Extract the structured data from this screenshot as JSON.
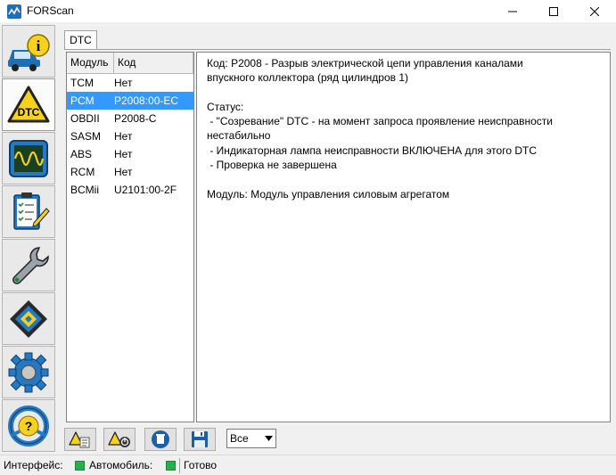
{
  "window": {
    "title": "FORScan"
  },
  "nav": {
    "items": [
      {
        "id": "info",
        "icon": "vehicle-info-icon"
      },
      {
        "id": "dtc",
        "icon": "dtc-warning-icon",
        "active": true
      },
      {
        "id": "oscilloscope",
        "icon": "oscilloscope-icon"
      },
      {
        "id": "tests",
        "icon": "checklist-icon"
      },
      {
        "id": "service",
        "icon": "wrench-icon"
      },
      {
        "id": "configuration",
        "icon": "chip-icon"
      },
      {
        "id": "settings",
        "icon": "gear-icon"
      },
      {
        "id": "help",
        "icon": "help-steering-icon"
      }
    ]
  },
  "tabs": [
    {
      "label": "DTC"
    }
  ],
  "modules": {
    "headers": {
      "module": "Модуль",
      "code": "Код"
    },
    "rows": [
      {
        "module": "TCM",
        "code": "Нет"
      },
      {
        "module": "PCM",
        "code": "P2008:00-EC",
        "selected": true
      },
      {
        "module": "OBDII",
        "code": "P2008-C"
      },
      {
        "module": "SASM",
        "code": "Нет"
      },
      {
        "module": "ABS",
        "code": "Нет"
      },
      {
        "module": "RCM",
        "code": "Нет"
      },
      {
        "module": "BCMii",
        "code": "U2101:00-2F"
      }
    ]
  },
  "details": {
    "line1": "Код: P2008 - Разрыв электрической цепи управления каналами",
    "line2": "впускного коллектора (ряд цилиндров 1)",
    "status_label": "Статус:",
    "status1a": " - \"Созревание\" DTC - на момент запроса проявление неисправности",
    "status1b": "нестабильно",
    "status2": " - Индикаторная лампа неисправности ВКЛЮЧЕНА для этого DTC",
    "status3": " - Проверка не завершена",
    "module_line": "Модуль: Модуль управления силовым агрегатом"
  },
  "toolbar": {
    "buttons": [
      {
        "id": "read-dtc",
        "icon": "read-dtc-icon"
      },
      {
        "id": "clear-dtc",
        "icon": "clear-dtc-icon"
      },
      {
        "id": "delete",
        "icon": "trash-icon"
      },
      {
        "id": "save",
        "icon": "floppy-save-icon"
      }
    ],
    "filter_value": "Все"
  },
  "status": {
    "interface_label": "Интерфейс:",
    "vehicle_label": "Автомобиль:",
    "state": "Готово",
    "led_color": "#22b14c"
  }
}
